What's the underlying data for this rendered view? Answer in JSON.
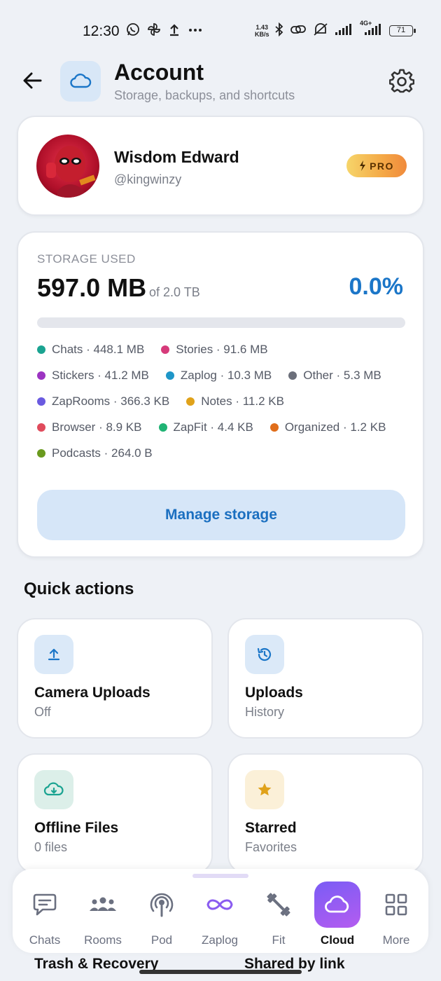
{
  "status_bar": {
    "time": "12:30",
    "left_icons": [
      "whatsapp-icon",
      "pinwheel-icon",
      "upload-icon",
      "more-dots-icon"
    ],
    "net_speed_value": "1.43",
    "net_speed_unit": "KB/s",
    "network": "4G+",
    "battery": "71"
  },
  "header": {
    "title": "Account",
    "subtitle": "Storage, backups, and shortcuts",
    "accent_color": "#1b76c8"
  },
  "profile": {
    "name": "Wisdom Edward",
    "handle": "@kingwinzy",
    "badge": "PRO"
  },
  "storage": {
    "label": "STORAGE USED",
    "used": "597.0 MB",
    "of_total": "of 2.0 TB",
    "percent_text": "0.0%",
    "percent_value": 0.0,
    "legend": [
      {
        "label": "Chats · 448.1 MB",
        "color": "#1aa391"
      },
      {
        "label": "Stories · 91.6 MB",
        "color": "#d63a7a"
      },
      {
        "label": "Stickers · 41.2 MB",
        "color": "#9c34c2"
      },
      {
        "label": "Zaplog · 10.3 MB",
        "color": "#1e96c8"
      },
      {
        "label": "Other · 5.3 MB",
        "color": "#6b6f7a"
      },
      {
        "label": "ZapRooms · 366.3 KB",
        "color": "#6a5ae0"
      },
      {
        "label": "Notes · 11.2 KB",
        "color": "#e0a21a"
      },
      {
        "label": "Browser · 8.9 KB",
        "color": "#e04b5c"
      },
      {
        "label": "ZapFit · 4.4 KB",
        "color": "#20b374"
      },
      {
        "label": "Organized · 1.2 KB",
        "color": "#e06d1a"
      },
      {
        "label": "Podcasts · 264.0 B",
        "color": "#6a9a1e"
      }
    ],
    "manage_label": "Manage storage"
  },
  "quick_actions": {
    "title": "Quick actions",
    "items": [
      {
        "title": "Camera Uploads",
        "subtitle": "Off",
        "icon": "upload-icon"
      },
      {
        "title": "Uploads",
        "subtitle": "History",
        "icon": "history-icon"
      },
      {
        "title": "Offline Files",
        "subtitle": "0 files",
        "icon": "cloud-download-icon"
      },
      {
        "title": "Starred",
        "subtitle": "Favorites",
        "icon": "star-icon"
      }
    ],
    "peek": [
      "Trash & Recovery",
      "Shared by link"
    ]
  },
  "nav": {
    "items": [
      {
        "label": "Chats",
        "icon": "chat-icon"
      },
      {
        "label": "Rooms",
        "icon": "people-icon"
      },
      {
        "label": "Pod",
        "icon": "podcast-icon"
      },
      {
        "label": "Zaplog",
        "icon": "infinity-icon"
      },
      {
        "label": "Fit",
        "icon": "dumbbell-icon"
      },
      {
        "label": "Cloud",
        "icon": "cloud-icon"
      },
      {
        "label": "More",
        "icon": "grid-icon"
      }
    ],
    "active": "Cloud"
  }
}
